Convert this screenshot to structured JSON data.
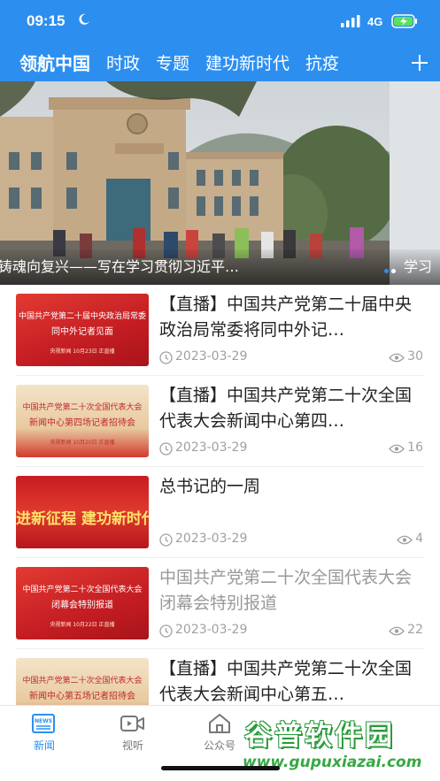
{
  "status_bar": {
    "time": "09:15",
    "network": "4G"
  },
  "nav": {
    "tabs": [
      {
        "label": "领航中国",
        "active": true
      },
      {
        "label": "时政",
        "active": false
      },
      {
        "label": "专题",
        "active": false
      },
      {
        "label": "建功新时代",
        "active": false
      },
      {
        "label": "抗疫",
        "active": false
      }
    ]
  },
  "banner": {
    "caption": "铸魂向复兴——写在学习贯彻习近平…",
    "next_caption": "学习",
    "slide_count": 2,
    "active_slide": 0
  },
  "news": [
    {
      "title": "【直播】中国共产党第二十届中央政治局常委将同中外记…",
      "date": "2023-03-29",
      "views": "30",
      "read": false,
      "thumb": {
        "line1": "中国共产党第二十届中央政治局常委",
        "line2": "同中外记者见面",
        "line3": "央视新闻   10月23日   正直播"
      }
    },
    {
      "title": "【直播】中国共产党第二十次全国代表大会新闻中心第四…",
      "date": "2023-03-29",
      "views": "16",
      "read": false,
      "thumb": {
        "line1": "中国共产党第二十次全国代表大会",
        "line2": "新闻中心第四场记者招待会",
        "line3": "央视新闻   10月20日   正直播"
      }
    },
    {
      "title": "总书记的一周",
      "date": "2023-03-29",
      "views": "4",
      "read": false,
      "thumb": {
        "line1": "",
        "line2": "进新征程  建功新时代",
        "line3": ""
      }
    },
    {
      "title": "中国共产党第二十次全国代表大会闭幕会特别报道",
      "date": "2023-03-29",
      "views": "22",
      "read": true,
      "thumb": {
        "line1": "中国共产党第二十次全国代表大会",
        "line2": "闭幕会特别报道",
        "line3": "央视新闻   10月22日   正直播"
      }
    },
    {
      "title": "【直播】中国共产党第二十次全国代表大会新闻中心第五…",
      "date": "",
      "views": "",
      "read": false,
      "thumb": {
        "line1": "中国共产党第二十次全国代表大会",
        "line2": "新闻中心第五场记者招待会",
        "line3": ""
      }
    }
  ],
  "bottom_tabs": [
    {
      "label": "新闻",
      "icon": "news-icon",
      "active": true
    },
    {
      "label": "视听",
      "icon": "video-icon",
      "active": false
    },
    {
      "label": "公众号",
      "icon": "house-icon",
      "active": false
    }
  ],
  "watermark": {
    "title": "谷普软件园",
    "url": "www.gupuxiazai.com"
  },
  "colors": {
    "brand_blue": "#2c8ff0",
    "thumb_red": "#d8242a",
    "watermark_green": "#36a845"
  }
}
